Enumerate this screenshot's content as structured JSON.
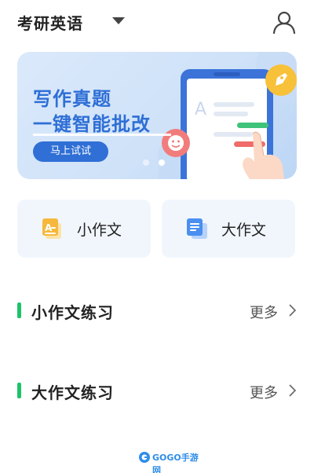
{
  "header": {
    "title": "考研英语",
    "caret_icon": "caret-down-icon",
    "user_icon": "user-profile-icon"
  },
  "banner": {
    "line1": "写作真题",
    "line2": "一键智能批改",
    "button_label": "马上试试",
    "carousel": {
      "total": 2,
      "active": 2
    },
    "illustration_icons": [
      "rocket-icon",
      "smiley-icon",
      "document-icon",
      "hand-icon"
    ]
  },
  "cards": [
    {
      "label": "小作文",
      "icon": "short-essay-icon",
      "accent": "#f6b83c"
    },
    {
      "label": "大作文",
      "icon": "long-essay-icon",
      "accent": "#4a8ff0"
    }
  ],
  "sections": [
    {
      "title": "小作文练习",
      "more_label": "更多"
    },
    {
      "title": "大作文练习",
      "more_label": "更多"
    }
  ],
  "footer": {
    "logo_text": "GOGO手游网"
  },
  "colors": {
    "accent_blue": "#2f6fd6",
    "section_bar_green": "#1ec26b",
    "card_bg": "#f1f6fd"
  }
}
